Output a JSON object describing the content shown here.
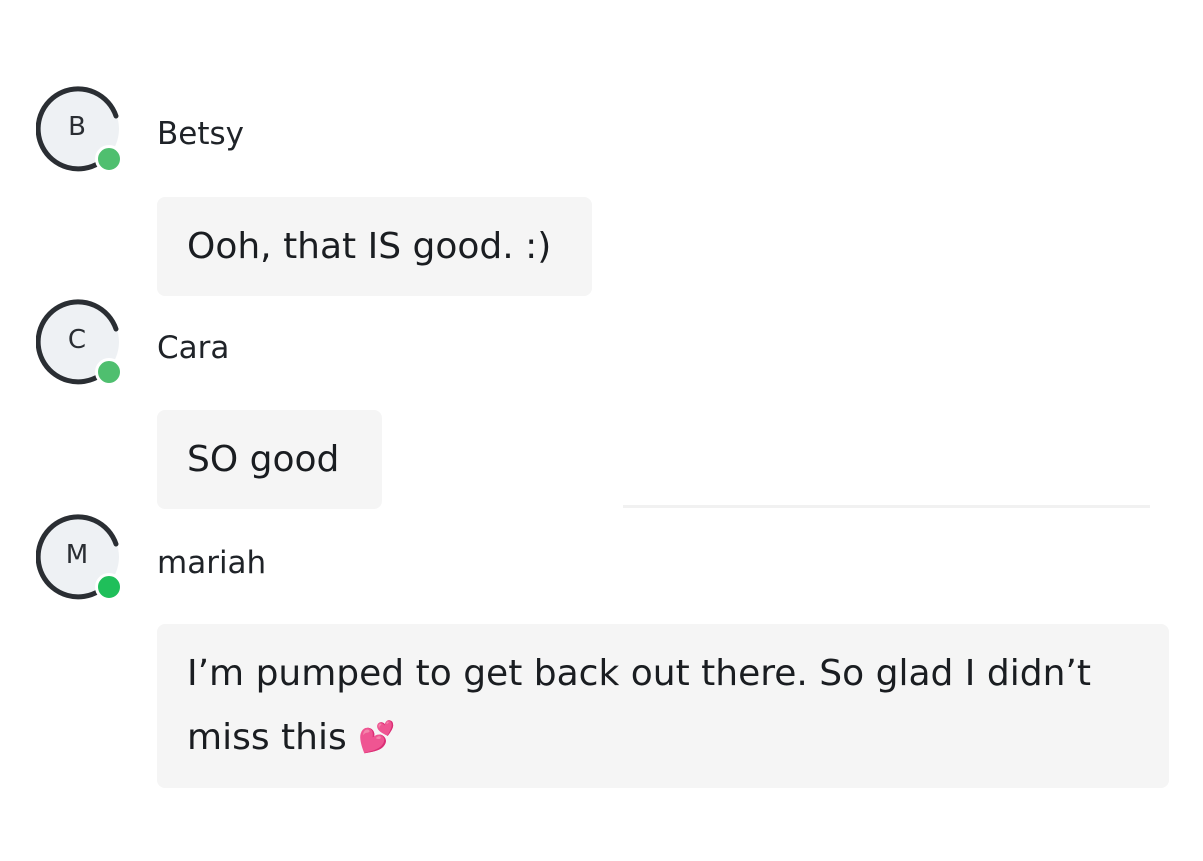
{
  "messages": [
    {
      "initial": "B",
      "sender": "Betsy",
      "text": "Ooh, that IS good. :)",
      "status_color": "#4fbf6f"
    },
    {
      "initial": "C",
      "sender": "Cara",
      "text": "SO good",
      "status_color": "#4fbf6f"
    },
    {
      "initial": "M",
      "sender": "mariah",
      "text_line1": "I’m pumped to get back out there. So glad I didn’t",
      "text_line2": "miss this",
      "emoji": "💕",
      "emoji_icon": "two-hearts-icon",
      "status_color": "#1fbf5a"
    }
  ],
  "colors": {
    "bubble_bg": "#f5f5f5",
    "avatar_ring": "#2a2e33",
    "avatar_bg": "#eef1f4"
  }
}
